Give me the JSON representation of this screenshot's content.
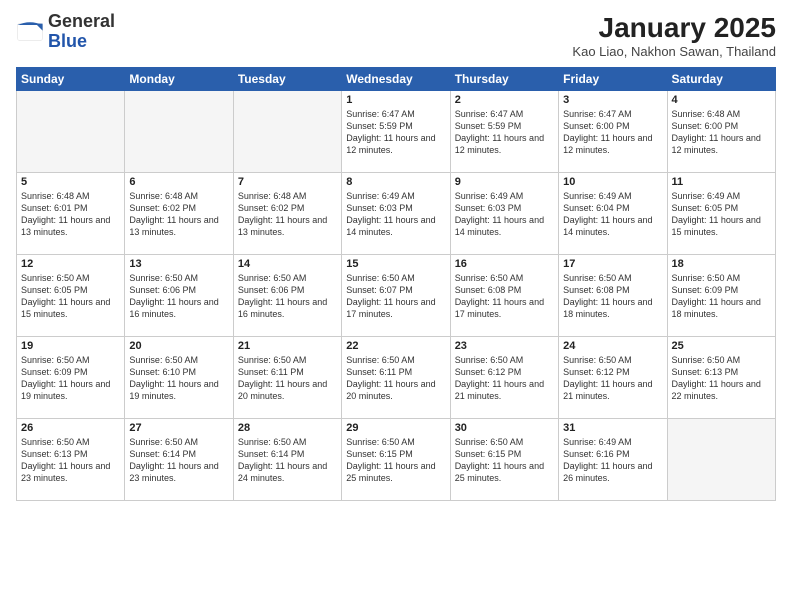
{
  "logo": {
    "text_general": "General",
    "text_blue": "Blue"
  },
  "title": "January 2025",
  "subtitle": "Kao Liao, Nakhon Sawan, Thailand",
  "weekdays": [
    "Sunday",
    "Monday",
    "Tuesday",
    "Wednesday",
    "Thursday",
    "Friday",
    "Saturday"
  ],
  "weeks": [
    [
      {
        "day": "",
        "info": ""
      },
      {
        "day": "",
        "info": ""
      },
      {
        "day": "",
        "info": ""
      },
      {
        "day": "1",
        "info": "Sunrise: 6:47 AM\nSunset: 5:59 PM\nDaylight: 11 hours and 12 minutes."
      },
      {
        "day": "2",
        "info": "Sunrise: 6:47 AM\nSunset: 5:59 PM\nDaylight: 11 hours and 12 minutes."
      },
      {
        "day": "3",
        "info": "Sunrise: 6:47 AM\nSunset: 6:00 PM\nDaylight: 11 hours and 12 minutes."
      },
      {
        "day": "4",
        "info": "Sunrise: 6:48 AM\nSunset: 6:00 PM\nDaylight: 11 hours and 12 minutes."
      }
    ],
    [
      {
        "day": "5",
        "info": "Sunrise: 6:48 AM\nSunset: 6:01 PM\nDaylight: 11 hours and 13 minutes."
      },
      {
        "day": "6",
        "info": "Sunrise: 6:48 AM\nSunset: 6:02 PM\nDaylight: 11 hours and 13 minutes."
      },
      {
        "day": "7",
        "info": "Sunrise: 6:48 AM\nSunset: 6:02 PM\nDaylight: 11 hours and 13 minutes."
      },
      {
        "day": "8",
        "info": "Sunrise: 6:49 AM\nSunset: 6:03 PM\nDaylight: 11 hours and 14 minutes."
      },
      {
        "day": "9",
        "info": "Sunrise: 6:49 AM\nSunset: 6:03 PM\nDaylight: 11 hours and 14 minutes."
      },
      {
        "day": "10",
        "info": "Sunrise: 6:49 AM\nSunset: 6:04 PM\nDaylight: 11 hours and 14 minutes."
      },
      {
        "day": "11",
        "info": "Sunrise: 6:49 AM\nSunset: 6:05 PM\nDaylight: 11 hours and 15 minutes."
      }
    ],
    [
      {
        "day": "12",
        "info": "Sunrise: 6:50 AM\nSunset: 6:05 PM\nDaylight: 11 hours and 15 minutes."
      },
      {
        "day": "13",
        "info": "Sunrise: 6:50 AM\nSunset: 6:06 PM\nDaylight: 11 hours and 16 minutes."
      },
      {
        "day": "14",
        "info": "Sunrise: 6:50 AM\nSunset: 6:06 PM\nDaylight: 11 hours and 16 minutes."
      },
      {
        "day": "15",
        "info": "Sunrise: 6:50 AM\nSunset: 6:07 PM\nDaylight: 11 hours and 17 minutes."
      },
      {
        "day": "16",
        "info": "Sunrise: 6:50 AM\nSunset: 6:08 PM\nDaylight: 11 hours and 17 minutes."
      },
      {
        "day": "17",
        "info": "Sunrise: 6:50 AM\nSunset: 6:08 PM\nDaylight: 11 hours and 18 minutes."
      },
      {
        "day": "18",
        "info": "Sunrise: 6:50 AM\nSunset: 6:09 PM\nDaylight: 11 hours and 18 minutes."
      }
    ],
    [
      {
        "day": "19",
        "info": "Sunrise: 6:50 AM\nSunset: 6:09 PM\nDaylight: 11 hours and 19 minutes."
      },
      {
        "day": "20",
        "info": "Sunrise: 6:50 AM\nSunset: 6:10 PM\nDaylight: 11 hours and 19 minutes."
      },
      {
        "day": "21",
        "info": "Sunrise: 6:50 AM\nSunset: 6:11 PM\nDaylight: 11 hours and 20 minutes."
      },
      {
        "day": "22",
        "info": "Sunrise: 6:50 AM\nSunset: 6:11 PM\nDaylight: 11 hours and 20 minutes."
      },
      {
        "day": "23",
        "info": "Sunrise: 6:50 AM\nSunset: 6:12 PM\nDaylight: 11 hours and 21 minutes."
      },
      {
        "day": "24",
        "info": "Sunrise: 6:50 AM\nSunset: 6:12 PM\nDaylight: 11 hours and 21 minutes."
      },
      {
        "day": "25",
        "info": "Sunrise: 6:50 AM\nSunset: 6:13 PM\nDaylight: 11 hours and 22 minutes."
      }
    ],
    [
      {
        "day": "26",
        "info": "Sunrise: 6:50 AM\nSunset: 6:13 PM\nDaylight: 11 hours and 23 minutes."
      },
      {
        "day": "27",
        "info": "Sunrise: 6:50 AM\nSunset: 6:14 PM\nDaylight: 11 hours and 23 minutes."
      },
      {
        "day": "28",
        "info": "Sunrise: 6:50 AM\nSunset: 6:14 PM\nDaylight: 11 hours and 24 minutes."
      },
      {
        "day": "29",
        "info": "Sunrise: 6:50 AM\nSunset: 6:15 PM\nDaylight: 11 hours and 25 minutes."
      },
      {
        "day": "30",
        "info": "Sunrise: 6:50 AM\nSunset: 6:15 PM\nDaylight: 11 hours and 25 minutes."
      },
      {
        "day": "31",
        "info": "Sunrise: 6:49 AM\nSunset: 6:16 PM\nDaylight: 11 hours and 26 minutes."
      },
      {
        "day": "",
        "info": ""
      }
    ]
  ]
}
